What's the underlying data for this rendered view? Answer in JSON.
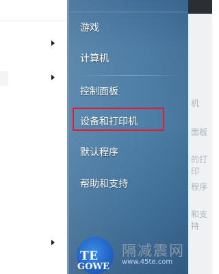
{
  "start_menu": {
    "right_items": [
      {
        "label": "游戏"
      },
      {
        "label": "计算机"
      },
      {
        "label": "控制面板"
      },
      {
        "label": "设备和打印机"
      },
      {
        "label": "默认程序"
      },
      {
        "label": "帮助和支持"
      }
    ],
    "highlighted_item": "设备和打印机",
    "highlight_color": "#e0202a",
    "pane_color": "#4a7aa3"
  },
  "background_window": {
    "fragments": [
      "机",
      "面板",
      "的打印",
      "程序",
      "和支持"
    ]
  },
  "watermark": {
    "logo_text": "TE",
    "logo_sub": "GOWE",
    "site_name": "隔减震网",
    "url": "www.45te.com"
  }
}
